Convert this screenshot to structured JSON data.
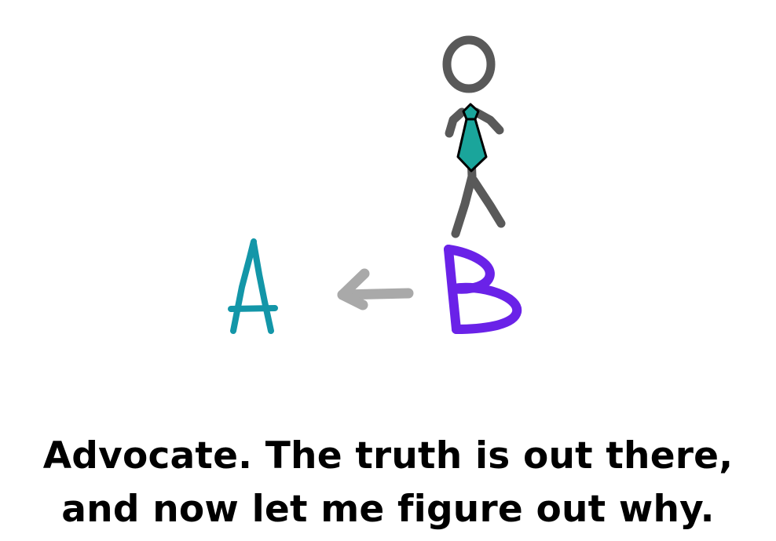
{
  "diagram": {
    "label_a": "A",
    "label_b": "B",
    "colors": {
      "label_a": "#1396a8",
      "label_b": "#6a22e8",
      "arrow": "#a9a9a9",
      "figure": "#595959",
      "tie": "#1aa59b",
      "tie_outline": "#000000"
    },
    "icons": [
      "stick-figure-icon",
      "tie-icon",
      "left-arrow-icon"
    ]
  },
  "caption": {
    "line1": "Advocate. The truth is out there,",
    "line2": "and now let me figure out why."
  }
}
